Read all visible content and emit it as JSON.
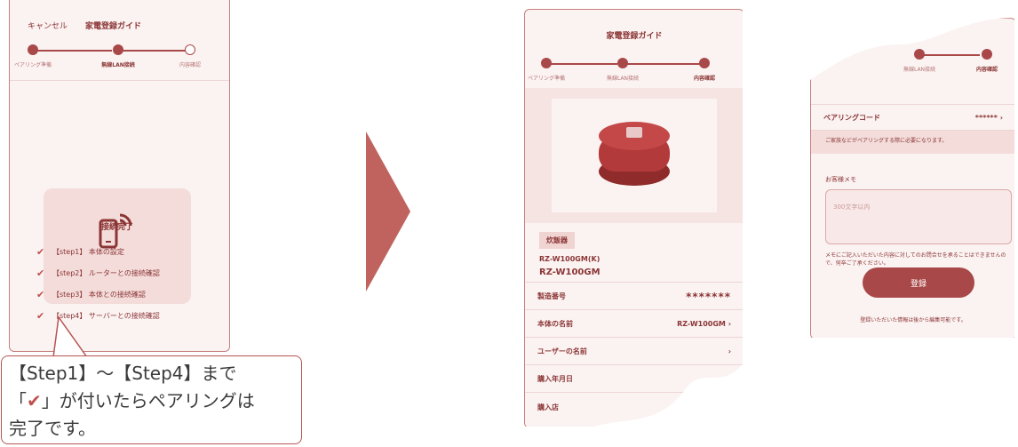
{
  "screen1": {
    "cancel": "キャンセル",
    "title": "家電登録ガイド",
    "steps": [
      "ペアリング準備",
      "無線LAN接続",
      "内容確認"
    ],
    "connected": "接続完了",
    "checklist": [
      "【step1】 本体の設定",
      "【step2】 ルーターとの接続確認",
      "【step3】 本体との接続確認",
      "【step4】 サーバーとの接続確認"
    ]
  },
  "screen2": {
    "title": "家電登録ガイド",
    "steps": [
      "ペアリング準備",
      "無線LAN接続",
      "内容確認"
    ],
    "category": "炊飯器",
    "model_code": "RZ-W100GM(K)",
    "model_name": "RZ-W100GM",
    "rows": [
      {
        "label": "製造番号",
        "value": "*******"
      },
      {
        "label": "本体の名前",
        "value": "RZ-W100GM"
      },
      {
        "label": "ユーザーの名前",
        "value": ""
      },
      {
        "label": "購入年月日",
        "value": ""
      },
      {
        "label": "購入店",
        "value": ""
      }
    ]
  },
  "screen3": {
    "steps": [
      "無線LAN接続",
      "内容確認"
    ],
    "pairing_code_label": "ペアリングコード",
    "pairing_code_value": "******",
    "pairing_note": "ご家族などがペアリングする際に必要になります。",
    "memo_label": "お客様メモ",
    "memo_placeholder": "300文字以内",
    "memo_note": "メモにご記入いただいた内容に対してのお問合せを承ることはできませんので、何卒ご了承ください。",
    "register_button": "登録",
    "footer_note": "登録いただいた情報は後から編集可能です。"
  },
  "callout": {
    "line1": "【Step1】～【Step4】まで",
    "line2_pre": "「",
    "line2_post": "」が付いたらペアリングは",
    "line3": "完了です。"
  },
  "colors": {
    "accent": "#a94848",
    "check": "#c0504d",
    "screen_bg": "#fbf3f2"
  },
  "icons": [
    "phone-wifi-icon",
    "check-icon",
    "chevron-right-icon",
    "arrow-right-icon"
  ]
}
